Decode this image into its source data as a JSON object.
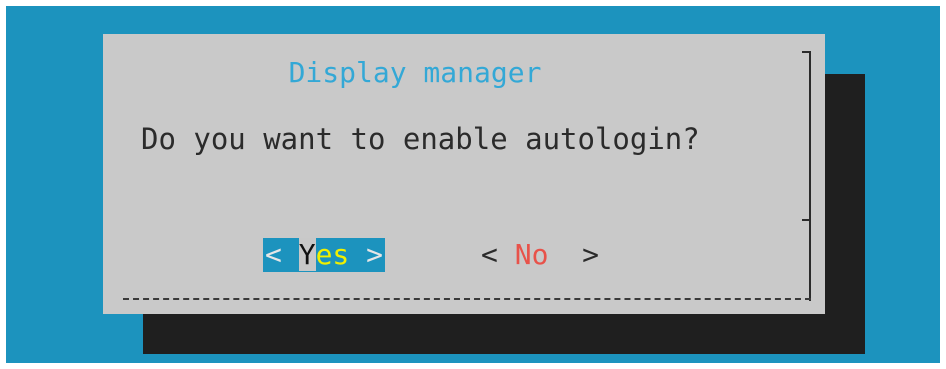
{
  "dialog": {
    "title": "Display manager",
    "question": "Do you want to enable autologin?"
  },
  "buttons": {
    "yes": {
      "left_bracket": "< ",
      "hotkey": "Y",
      "rest": "es",
      "right_bracket": " >",
      "selected": true
    },
    "no": {
      "left_bracket": "< ",
      "hotkey": "N",
      "rest": "o",
      "right_bracket": "  >",
      "selected": false
    }
  },
  "colors": {
    "background": "#1c93be",
    "dialog": "#c9c9c9",
    "shadow": "#1f1f1f",
    "title": "#33a8d6",
    "yes_highlight": "#f0f000",
    "no_highlight": "#e8524a"
  }
}
